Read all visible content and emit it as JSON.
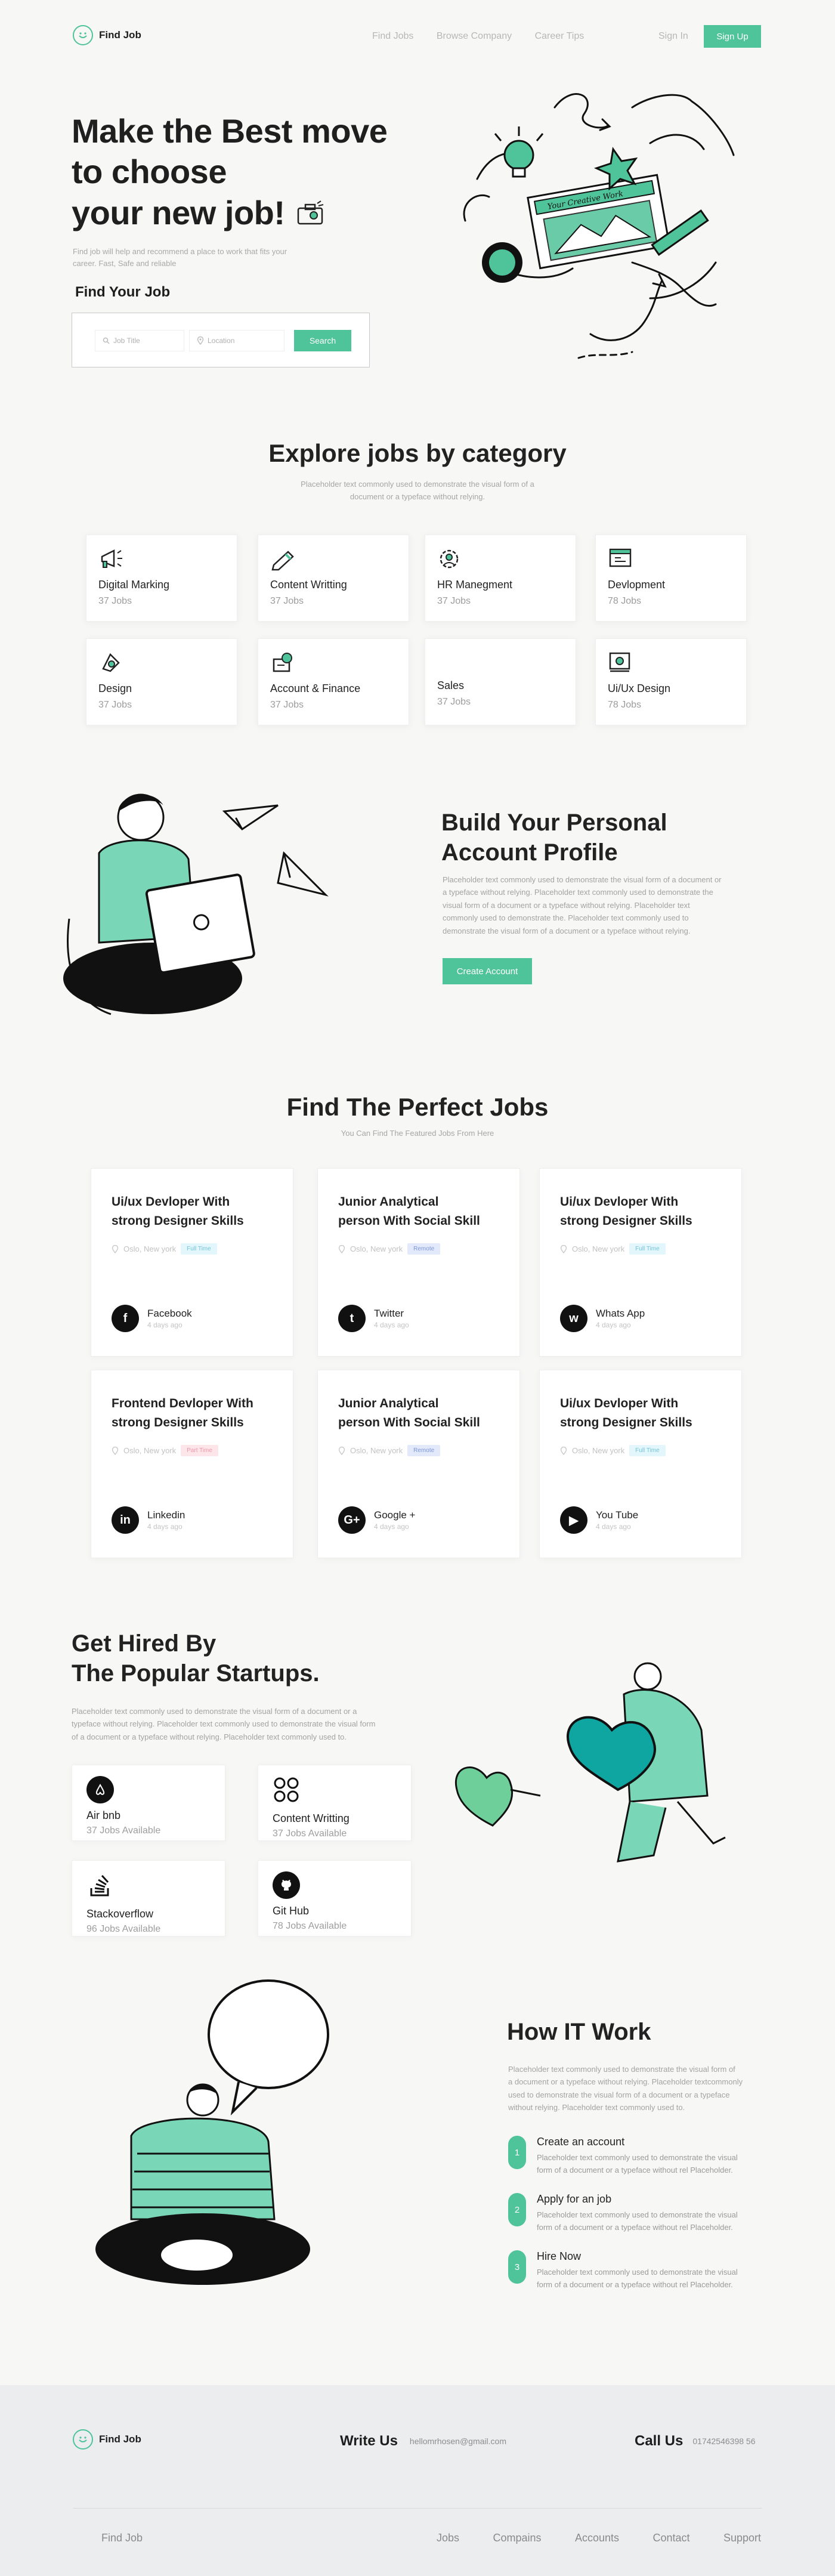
{
  "header": {
    "logo_text": "Find Job",
    "nav": [
      "Find Jobs",
      "Browse Company",
      "Career Tips"
    ],
    "signin": "Sign In",
    "signup": "Sign Up"
  },
  "hero": {
    "title_l1": "Make the Best move",
    "title_l2": "to choose",
    "title_l3": "your new job!",
    "subtitle_l1": "Find job will help and recommend a place to work that fits your",
    "subtitle_l2": "career. Fast, Safe and reliable",
    "find_label": "Find Your Job",
    "job_title_placeholder": "Job Title",
    "location_placeholder": "Location",
    "search_button": "Search",
    "illustration_banner": "Your Creative Work"
  },
  "categories": {
    "title": "Explore jobs by category",
    "subtitle_l1": "Placeholder text commonly used to demonstrate the visual form of a",
    "subtitle_l2": "document or a typeface without relying.",
    "items": [
      {
        "name": "Digital Marking",
        "count": "37 Jobs",
        "icon": "megaphone-icon"
      },
      {
        "name": "Content Writting",
        "count": "37 Jobs",
        "icon": "pencil-icon"
      },
      {
        "name": "HR Manegment",
        "count": "37 Jobs",
        "icon": "gear-user-icon"
      },
      {
        "name": "Devlopment",
        "count": "78 Jobs",
        "icon": "code-window-icon"
      },
      {
        "name": "Design",
        "count": "37 Jobs",
        "icon": "design-icon"
      },
      {
        "name": "Account & Finance",
        "count": "37 Jobs",
        "icon": "finance-icon"
      },
      {
        "name": "Sales",
        "count": "37 Jobs",
        "icon": ""
      },
      {
        "name": "Ui/Ux Design",
        "count": "78 Jobs",
        "icon": "ui-design-icon"
      }
    ]
  },
  "profile": {
    "title_l1": "Build Your Personal",
    "title_l2": "Account Profile",
    "body": [
      "Placeholder text commonly used to demonstrate the visual form of a document or",
      "a typeface without relying. Placeholder text commonly used to demonstrate the",
      "visual form of a document or a typeface without relying. Placeholder text",
      "commonly used to demonstrate the. Placeholder text commonly used to",
      "demonstrate the visual form of a document or a typeface without relying."
    ],
    "button": "Create Account"
  },
  "jobs": {
    "title": "Find The Perfect Jobs",
    "subtitle": "You Can Find The Featured Jobs From Here",
    "items": [
      {
        "t1": "Ui/ux Devloper With",
        "t2": "strong Designer Skills",
        "loc": "Oslo, New york",
        "tag": "Full Time",
        "tag_kind": "ft",
        "company": "Facebook",
        "ago": "4 days ago",
        "glyph": "f"
      },
      {
        "t1": "Junior Analytical",
        "t2": "person With Social Skill",
        "loc": "Oslo, New york",
        "tag": "Remote",
        "tag_kind": "rm",
        "company": "Twitter",
        "ago": "4 days ago",
        "glyph": "t"
      },
      {
        "t1": "Ui/ux Devloper With",
        "t2": "strong Designer Skills",
        "loc": "Oslo, New york",
        "tag": "Full Time",
        "tag_kind": "ft",
        "company": "Whats App",
        "ago": "4 days ago",
        "glyph": "w"
      },
      {
        "t1": "Frontend Devloper With",
        "t2": "strong Designer Skills",
        "loc": "Oslo, New york",
        "tag": "Part Time",
        "tag_kind": "pt",
        "company": "Linkedin",
        "ago": "4 days ago",
        "glyph": "in"
      },
      {
        "t1": "Junior Analytical",
        "t2": "person With Social Skill",
        "loc": "Oslo, New york",
        "tag": "Remote",
        "tag_kind": "rm",
        "company": "Google +",
        "ago": "4 days ago",
        "glyph": "G+"
      },
      {
        "t1": "Ui/ux Devloper With",
        "t2": "strong Designer Skills",
        "loc": "Oslo, New york",
        "tag": "Full Time",
        "tag_kind": "ft",
        "company": "You Tube",
        "ago": "4 days ago",
        "glyph": "▶"
      }
    ]
  },
  "startups": {
    "title_l1": "Get Hired By",
    "title_l2": "The Popular Startups.",
    "body": [
      "Placeholder text commonly used to demonstrate the visual form of a document or a",
      "typeface without relying. Placeholder text commonly used to demonstrate the visual form",
      "of a document or a typeface without relying. Placeholder text commonly used to."
    ],
    "items": [
      {
        "name": "Air bnb",
        "count": "37 Jobs Available",
        "icon": "airbnb-icon"
      },
      {
        "name": "Content Writting",
        "count": "37 Jobs Available",
        "icon": "circles-icon"
      },
      {
        "name": "Stackoverflow",
        "count": "96 Jobs Available",
        "icon": "stackoverflow-icon"
      },
      {
        "name": "Git Hub",
        "count": "78 Jobs Available",
        "icon": "github-icon"
      }
    ]
  },
  "how": {
    "title": "How IT Work",
    "body": [
      "Placeholder text commonly used to demonstrate the visual form of",
      "a document or a typeface without relying. Placeholder textcommonly",
      "used to demonstrate the visual form of a document or a typeface",
      "without relying. Placeholder text commonly used to."
    ],
    "steps": [
      {
        "n": "1",
        "title": "Create an account",
        "d1": "Placeholder text commonly used to demonstrate the visual",
        "d2": "form of a document or a typeface without rel Placeholder."
      },
      {
        "n": "2",
        "title": "Apply for an job",
        "d1": "Placeholder text commonly used to demonstrate the visual",
        "d2": "form of a document or a typeface without rel Placeholder."
      },
      {
        "n": "3",
        "title": "Hire Now",
        "d1": "Placeholder text commonly used to demonstrate the visual",
        "d2": "form of a document or a typeface without rel Placeholder."
      }
    ]
  },
  "footer": {
    "logo_text": "Find Job",
    "write_label": "Write Us",
    "email": "hellomrhosen@gmail.com",
    "call_label": "Call Us",
    "phone": "01742546398 56",
    "bottom_brand": "Find Job",
    "links": [
      "Jobs",
      "Compains",
      "Accounts",
      "Contact",
      "Support"
    ]
  },
  "colors": {
    "accent": "#4fc39a",
    "text": "#1d1d1d",
    "footer_bg": "#ebedee"
  }
}
